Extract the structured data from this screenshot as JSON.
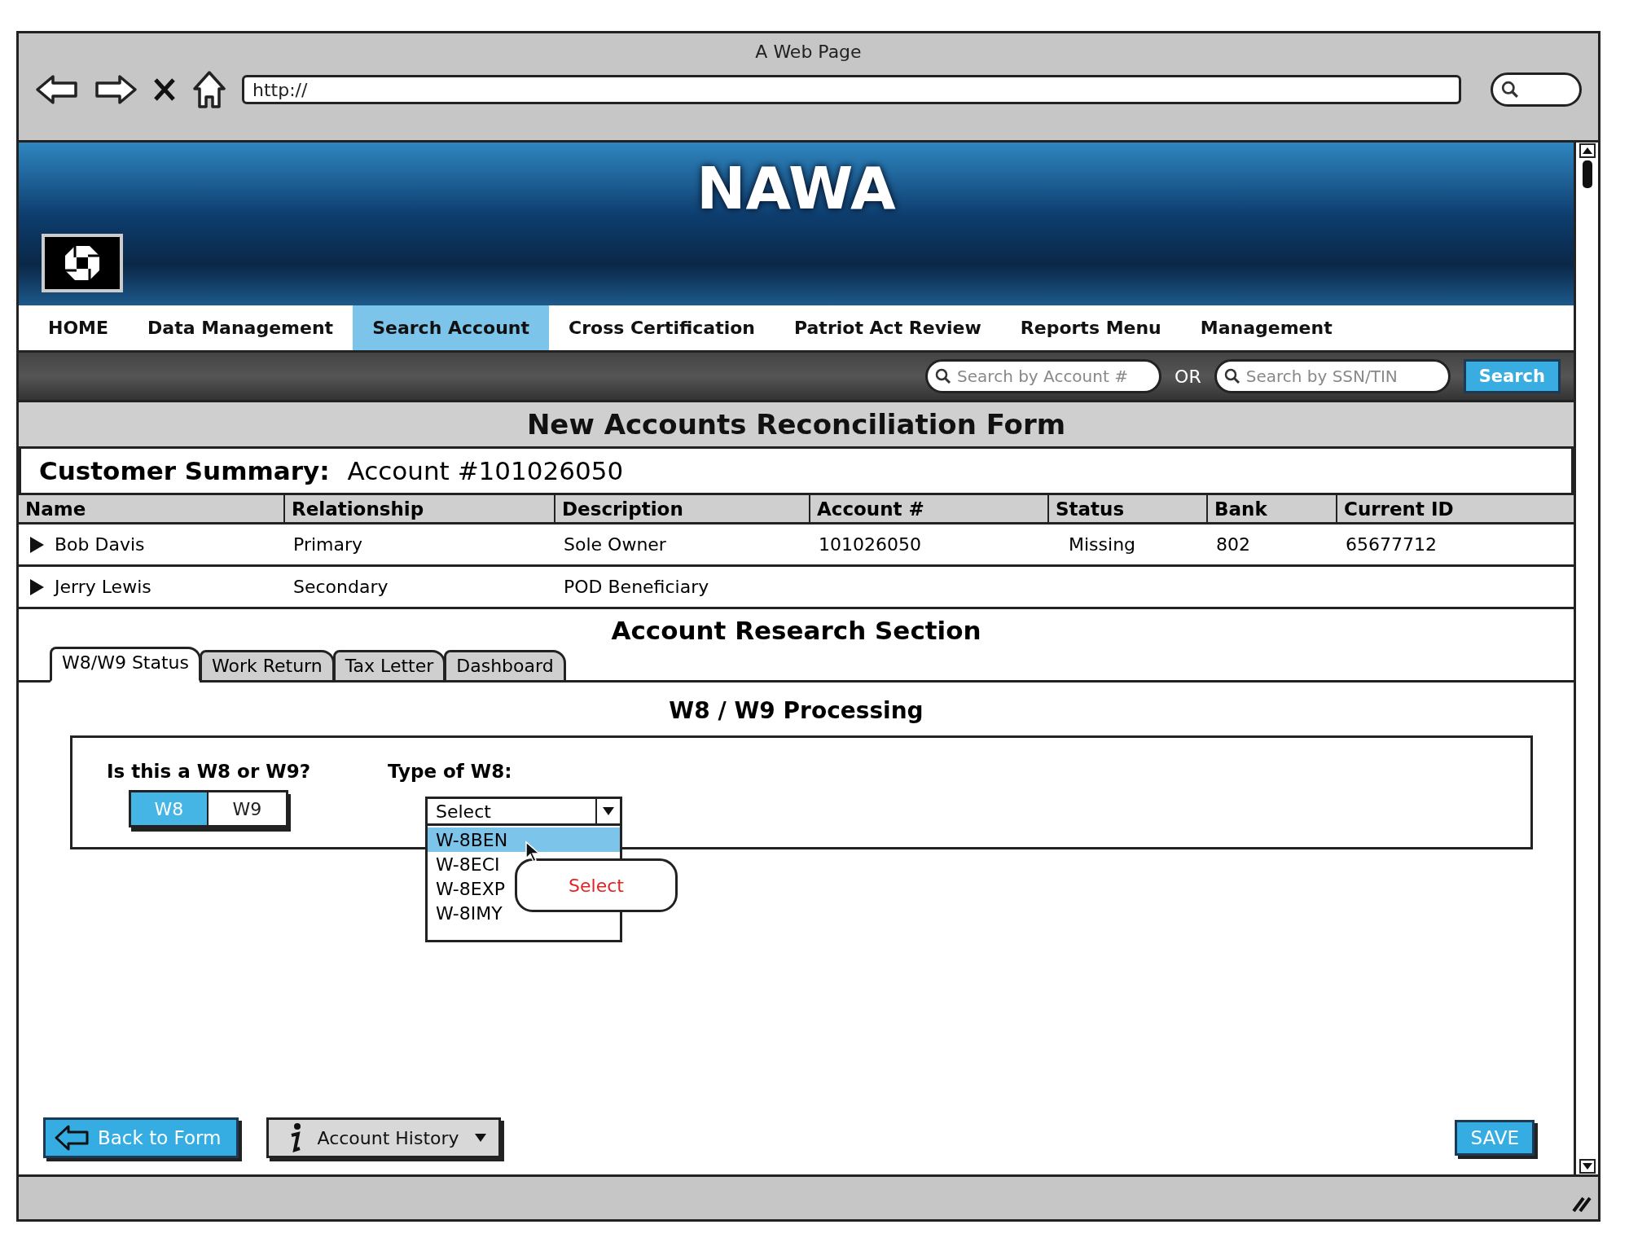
{
  "browser": {
    "title": "A Web Page",
    "url": "http://"
  },
  "banner": {
    "title": "NAWA"
  },
  "nav": [
    {
      "label": "HOME",
      "selected": false
    },
    {
      "label": "Data Management",
      "selected": false
    },
    {
      "label": "Search Account",
      "selected": true
    },
    {
      "label": "Cross Certification",
      "selected": false
    },
    {
      "label": "Patriot Act Review",
      "selected": false
    },
    {
      "label": "Reports Menu",
      "selected": false
    },
    {
      "label": "Management",
      "selected": false
    }
  ],
  "search": {
    "account_placeholder": "Search by Account #",
    "or": "OR",
    "ssn_placeholder": "Search by SSN/TIN",
    "button": "Search"
  },
  "form_title": "New Accounts Reconciliation Form",
  "summary": {
    "label": "Customer Summary:",
    "account": "Account #101026050"
  },
  "table": {
    "columns": [
      "Name",
      "Relationship",
      "Description",
      "Account #",
      "Status",
      "Bank",
      "Current ID"
    ],
    "rows": [
      {
        "cells": [
          "Bob Davis",
          "Primary",
          "Sole Owner",
          "101026050",
          "Missing",
          "802",
          "65677712"
        ]
      },
      {
        "cells": [
          "Jerry Lewis",
          "Secondary",
          "POD Beneficiary"
        ]
      }
    ]
  },
  "section_title": "Account Research Section",
  "tabs": [
    {
      "label": "W8/W9 Status",
      "selected": true
    },
    {
      "label": "Work Return",
      "selected": false
    },
    {
      "label": "Tax Letter",
      "selected": false
    },
    {
      "label": "Dashboard",
      "selected": false
    }
  ],
  "panel_title": "W8 / W9 Processing",
  "question": {
    "label": "Is this a W8 or W9?",
    "options": [
      {
        "label": "W8",
        "selected": true
      },
      {
        "label": "W9",
        "selected": false
      }
    ]
  },
  "w8_type": {
    "label": "Type of W8:",
    "value": "Select",
    "options": [
      {
        "label": "W-8BEN",
        "selected": true
      },
      {
        "label": "W-8ECI",
        "selected": false
      },
      {
        "label": "W-8EXP",
        "selected": false
      },
      {
        "label": "W-8IMY",
        "selected": false
      }
    ]
  },
  "tooltip": "Select",
  "buttons": {
    "back": "Back to Form",
    "history": "Account History",
    "save": "SAVE"
  }
}
